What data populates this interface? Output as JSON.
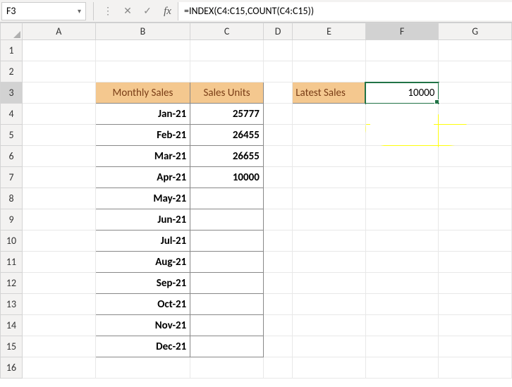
{
  "name_box": "F3",
  "formula": "=INDEX(C4:C15,COUNT(C4:C15))",
  "columns": [
    "A",
    "B",
    "C",
    "D",
    "E",
    "F",
    "G"
  ],
  "rows": [
    "1",
    "2",
    "3",
    "4",
    "5",
    "6",
    "7",
    "8",
    "9",
    "10",
    "11",
    "12",
    "13",
    "14",
    "15",
    "16"
  ],
  "icons": {
    "cancel": "✕",
    "confirm": "✓",
    "fx": "fx",
    "dropdown": "▾",
    "expand": "⋮"
  },
  "header_b": "Monthly Sales",
  "header_c": "Sales Units",
  "months": {
    "r4": "Jan-21",
    "r5": "Feb-21",
    "r6": "Mar-21",
    "r7": "Apr-21",
    "r8": "May-21",
    "r9": "Jun-21",
    "r10": "Jul-21",
    "r11": "Aug-21",
    "r12": "Sep-21",
    "r13": "Oct-21",
    "r14": "Nov-21",
    "r15": "Dec-21"
  },
  "sales": {
    "r4": "25777",
    "r5": "26455",
    "r6": "26655",
    "r7": "10000",
    "r8": "",
    "r9": "",
    "r10": "",
    "r11": "",
    "r12": "",
    "r13": "",
    "r14": "",
    "r15": ""
  },
  "latest_label": "Latest Sales",
  "latest_value": "10000",
  "active_col": "F",
  "active_row": "3"
}
